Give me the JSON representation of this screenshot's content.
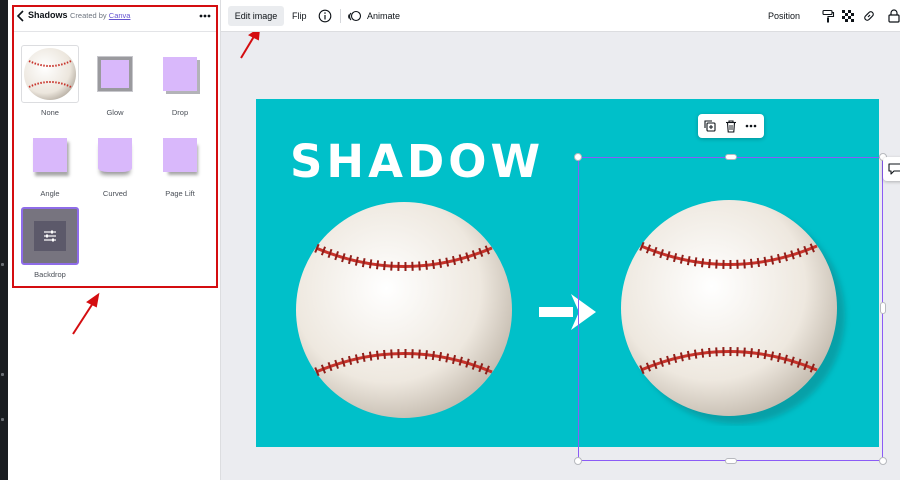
{
  "panel": {
    "title": "Shadows",
    "credit_prefix": "Created by",
    "credit_link": "Canva",
    "effects": [
      {
        "label": "None"
      },
      {
        "label": "Glow"
      },
      {
        "label": "Drop"
      },
      {
        "label": "Angle"
      },
      {
        "label": "Curved"
      },
      {
        "label": "Page Lift"
      },
      {
        "label": "Backdrop"
      }
    ]
  },
  "toolbar": {
    "edit_image": "Edit image",
    "flip": "Flip",
    "animate": "Animate",
    "position": "Position"
  },
  "canvas": {
    "headline": "SHADOW",
    "background": "#00c0c9"
  },
  "colors": {
    "annotation_red": "#d40d10",
    "selection_purple": "#8b5cf6",
    "swatch_lilac": "#d9b8fb",
    "stitch_red": "#c8322a"
  },
  "icons": {
    "back": "chevron-left-icon",
    "more": "more-horizontal-icon",
    "info": "info-icon",
    "animate": "animate-icon",
    "paint_roller": "paint-roller-icon",
    "transparency": "transparency-icon",
    "link": "link-icon",
    "lock": "lock-icon",
    "duplicate": "duplicate-icon",
    "trash": "trash-icon",
    "comment": "comment-icon",
    "arrow": "arrow-right-icon",
    "adjust": "sliders-icon"
  }
}
